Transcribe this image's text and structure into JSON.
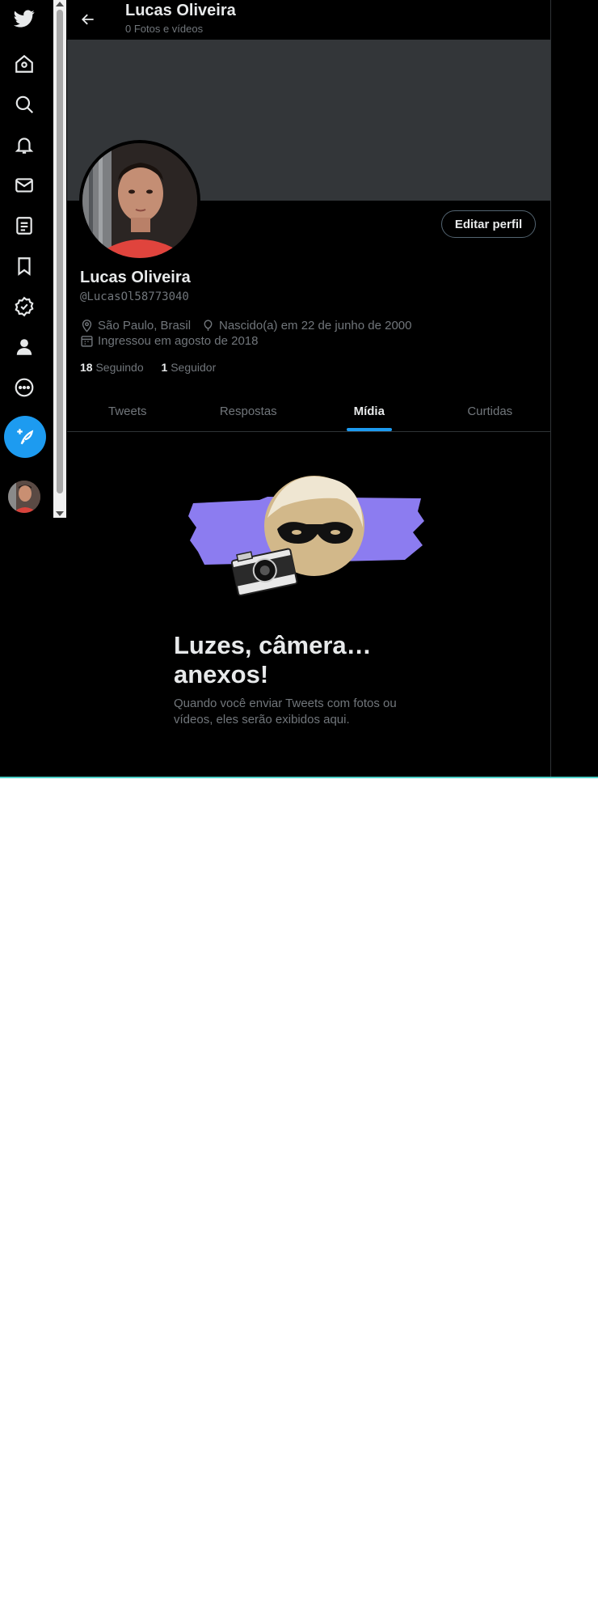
{
  "header": {
    "name": "Lucas Oliveira",
    "subtitle": "0 Fotos e vídeos"
  },
  "profile": {
    "name": "Lucas Oliveira",
    "handle": "@LucasOl58773040",
    "location": "São Paulo, Brasil",
    "birth": "Nascido(a) em 22 de junho de 2000",
    "joined": "Ingressou em agosto de 2018",
    "following_count": "18",
    "following_label": "Seguindo",
    "followers_count": "1",
    "followers_label": "Seguidor",
    "edit_label": "Editar perfil"
  },
  "tabs": [
    {
      "label": "Tweets",
      "active": false
    },
    {
      "label": "Respostas",
      "active": false
    },
    {
      "label": "Mídia",
      "active": true
    },
    {
      "label": "Curtidas",
      "active": false
    }
  ],
  "empty_state": {
    "title": "Luzes, câmera… anexos!",
    "description": "Quando você enviar Tweets com fotos ou vídeos, eles serão exibidos aqui."
  },
  "sidebar": {
    "items": [
      "twitter-logo",
      "home",
      "explore",
      "notifications",
      "messages",
      "lists",
      "bookmarks",
      "verified",
      "profile",
      "more"
    ]
  },
  "colors": {
    "accent": "#1d9bf0",
    "background": "#000000",
    "banner": "#333639",
    "muted": "#71767b",
    "text": "#e7e9ea",
    "illustration": "#8c7cf0"
  }
}
